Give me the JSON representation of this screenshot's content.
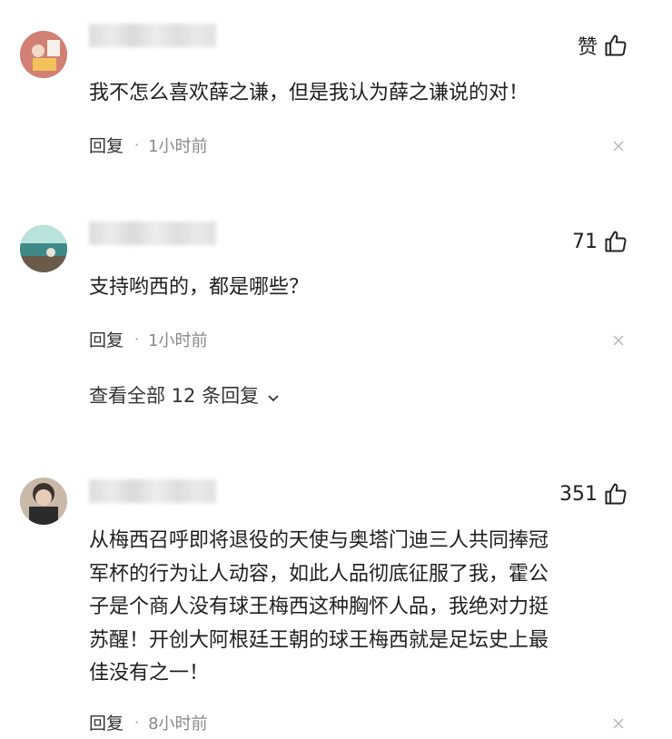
{
  "comments": [
    {
      "like_label": "赞",
      "text": "我不怎么喜欢薛之谦，但是我认为薛之谦说的对！",
      "reply_label": "回复",
      "dot": "·",
      "time": "1小时前"
    },
    {
      "like_label": "71",
      "text": "支持哟西的，都是哪些？",
      "reply_label": "回复",
      "dot": "·",
      "time": "1小时前",
      "view_all": "查看全部 12 条回复"
    },
    {
      "like_label": "351",
      "text_lines": [
        "从梅西召呼即将退役的天使与奥塔门迪三人共同捧冠",
        "军杯的行为让人动容，如此人品彻底征服了我，霍公",
        "子是个商人没有球王梅西这种胸怀人品，我绝对力挺",
        "苏醒！开创大阿根廷王朝的球王梅西就是足坛史上最",
        "佳没有之一！"
      ],
      "reply_label": "回复",
      "dot": "·",
      "time": "8小时前"
    }
  ],
  "icons": {
    "like": "thumbs-up-icon",
    "close": "close-icon",
    "chevron": "chevron-down-icon"
  }
}
